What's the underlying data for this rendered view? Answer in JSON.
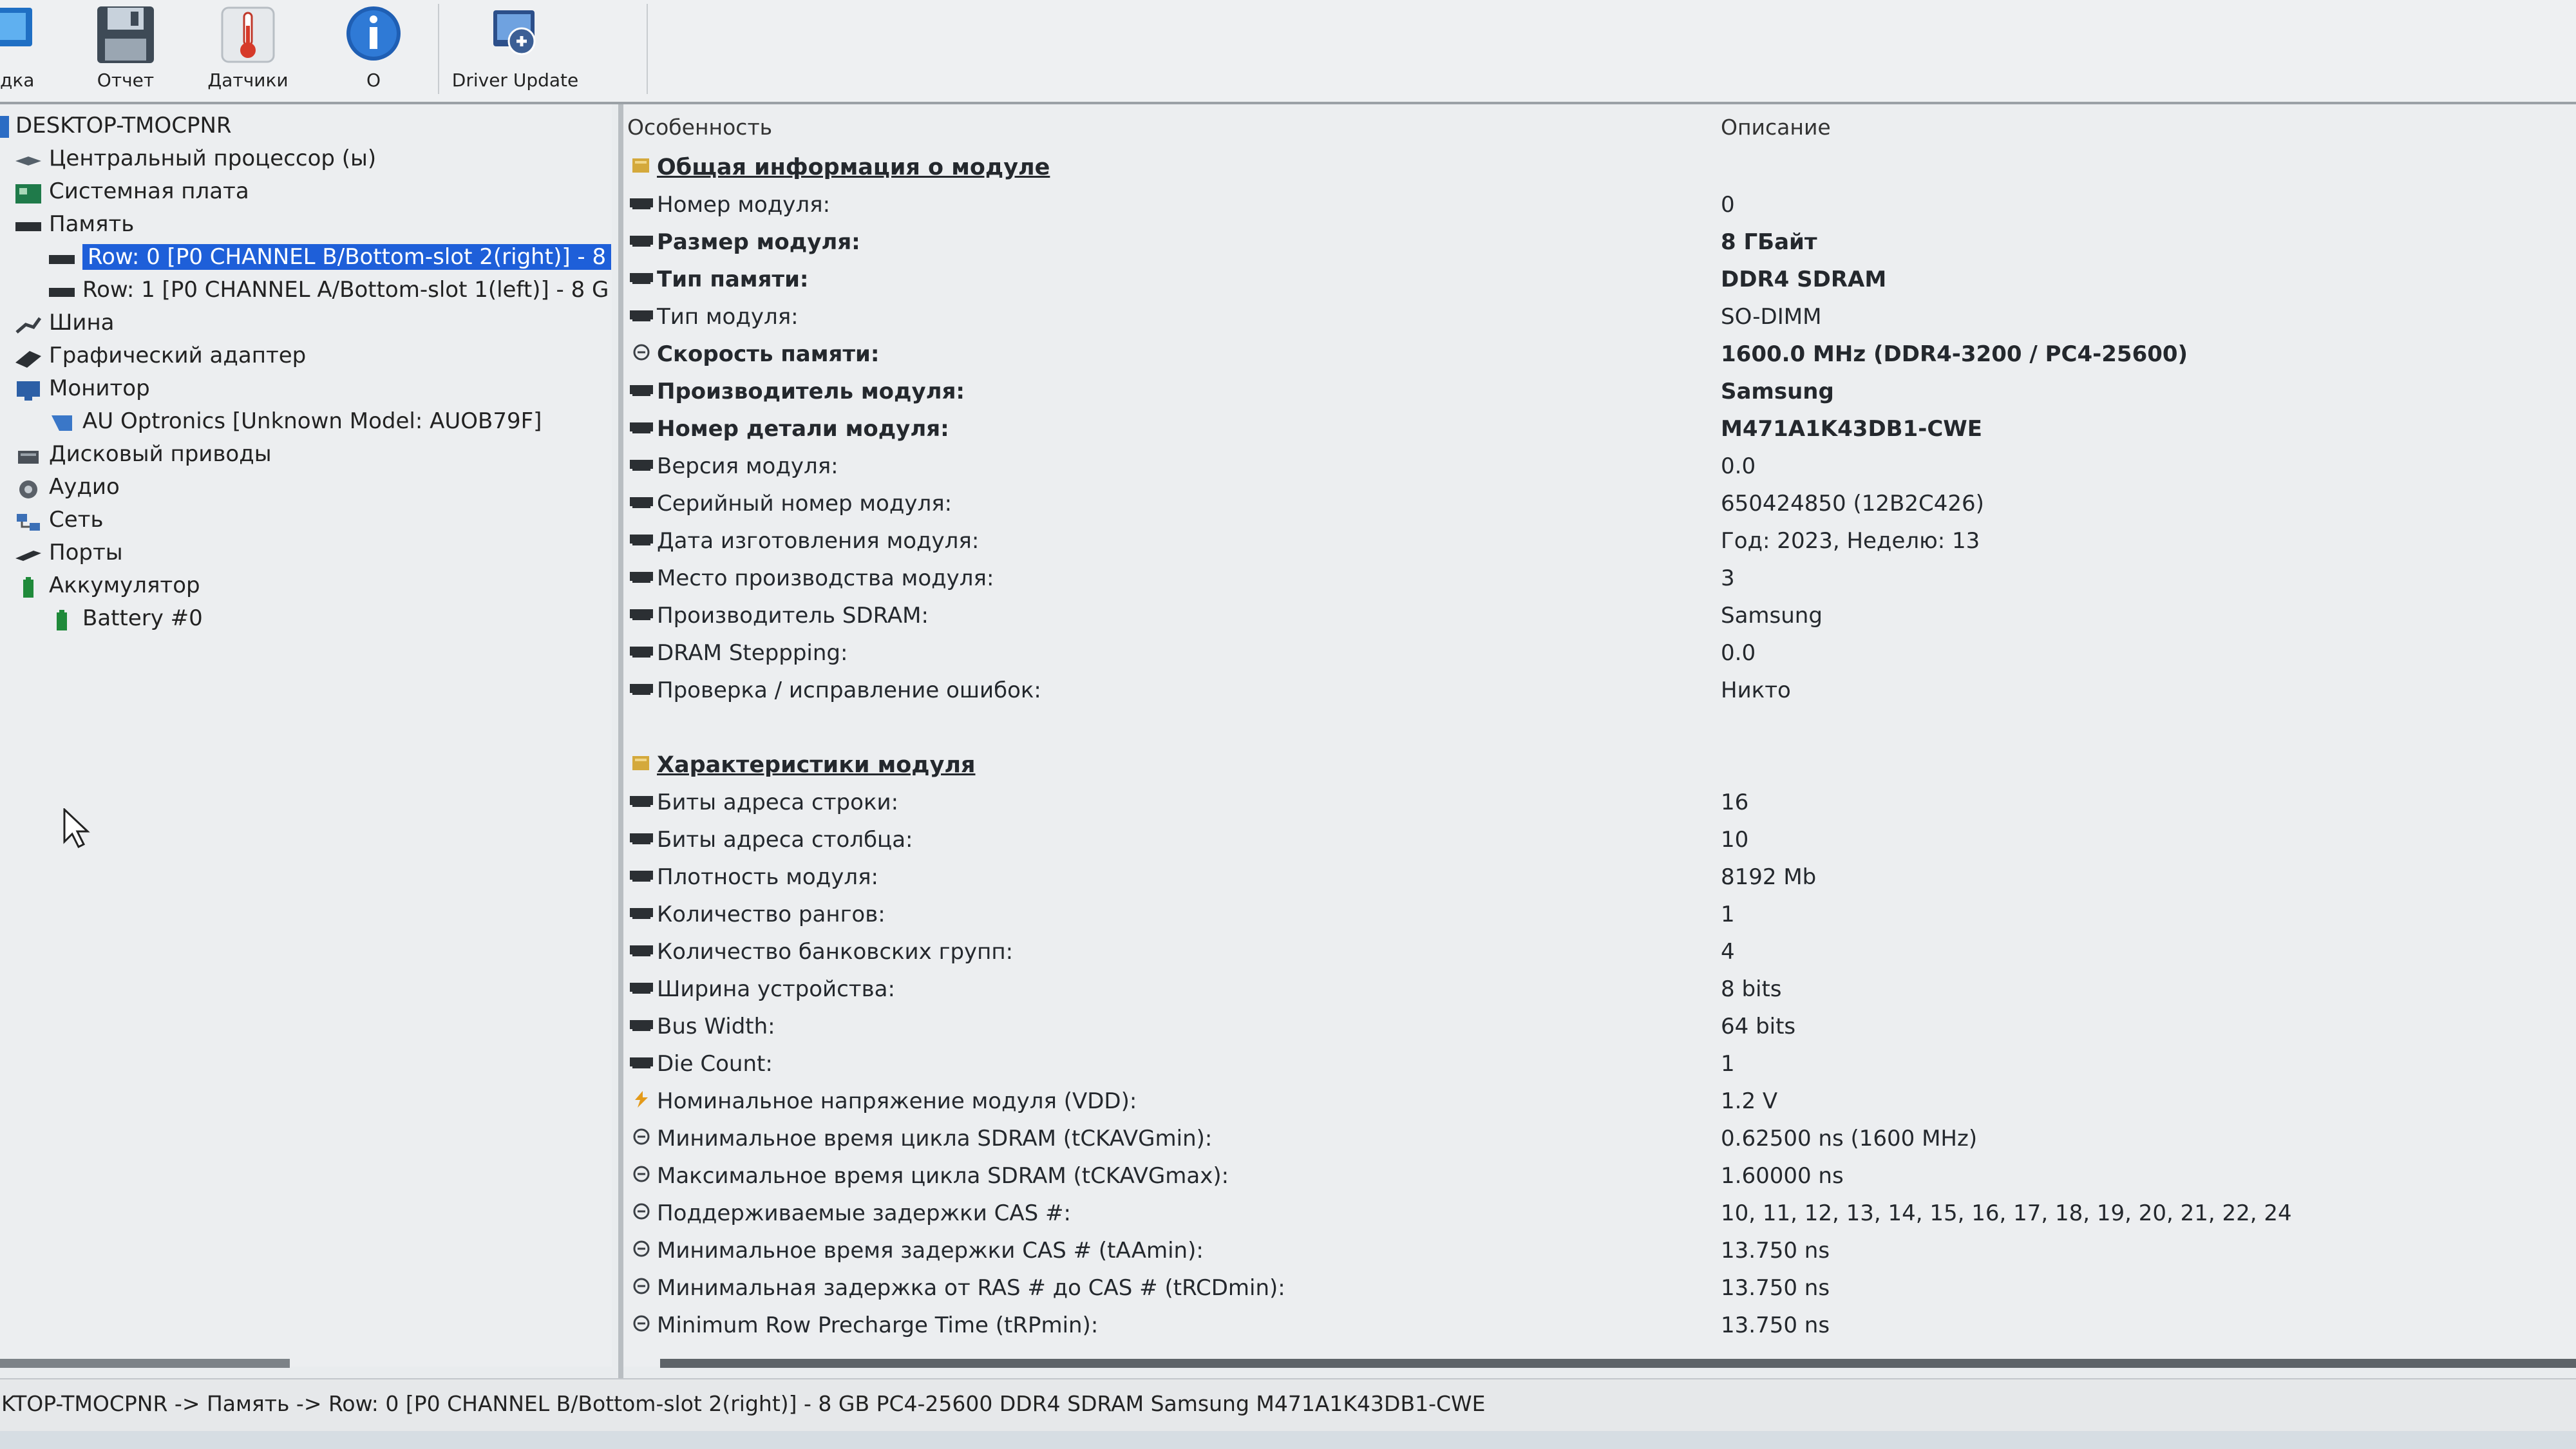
{
  "toolbar": {
    "buttons": [
      {
        "label": "дка",
        "icon": "monitor-icon"
      },
      {
        "label": "Отчет",
        "icon": "floppy-disk-icon"
      },
      {
        "label": "Датчики",
        "icon": "thermometer-icon"
      },
      {
        "label": "О",
        "icon": "info-icon"
      },
      {
        "label": "Driver Update",
        "icon": "driver-update-icon"
      }
    ]
  },
  "tree": {
    "items": [
      {
        "label": "DESKTOP-TMOCPNR",
        "icon": "computer-icon"
      },
      {
        "label": "Центральный процессор (ы)",
        "icon": "cpu-icon"
      },
      {
        "label": "Системная плата",
        "icon": "motherboard-icon"
      },
      {
        "label": "Память",
        "icon": "memory-icon"
      },
      {
        "label": "Row: 0 [P0 CHANNEL B/Bottom-slot 2(right)] - 8",
        "icon": "memory-module-icon",
        "selected": true
      },
      {
        "label": "Row: 1 [P0 CHANNEL A/Bottom-slot 1(left)] - 8 G",
        "icon": "memory-module-icon"
      },
      {
        "label": "Шина",
        "icon": "bus-icon"
      },
      {
        "label": "Графический адаптер",
        "icon": "gpu-icon"
      },
      {
        "label": "Монитор",
        "icon": "monitor-icon"
      },
      {
        "label": "AU Optronics [Unknown Model: AUOB79F]",
        "icon": "display-icon"
      },
      {
        "label": "Дисковый приводы",
        "icon": "disk-icon"
      },
      {
        "label": "Аудио",
        "icon": "audio-icon"
      },
      {
        "label": "Сеть",
        "icon": "network-icon"
      },
      {
        "label": "Порты",
        "icon": "ports-icon"
      },
      {
        "label": "Аккумулятор",
        "icon": "battery-icon"
      },
      {
        "label": "Battery #0",
        "icon": "battery-icon"
      }
    ]
  },
  "list": {
    "headers": {
      "feature": "Особенность",
      "description": "Описание"
    },
    "rows": [
      {
        "feature": "Общая информация о модуле",
        "value": "",
        "type": "section",
        "icon": "folder-icon"
      },
      {
        "feature": "Номер модуля:",
        "value": "0",
        "icon": "memory-module-icon"
      },
      {
        "feature": "Размер модуля:",
        "value": "8 ГБайт",
        "type": "bold",
        "icon": "memory-module-icon"
      },
      {
        "feature": "Тип памяти:",
        "value": "DDR4 SDRAM",
        "type": "bold",
        "icon": "memory-module-icon"
      },
      {
        "feature": "Тип модуля:",
        "value": "SO-DIMM",
        "icon": "memory-module-icon"
      },
      {
        "feature": "Скорость памяти:",
        "value": "1600.0 MHz (DDR4-3200 / PC4-25600)",
        "type": "bold",
        "icon": "clock-icon"
      },
      {
        "feature": "Производитель модуля:",
        "value": "Samsung",
        "type": "bold",
        "icon": "memory-module-icon"
      },
      {
        "feature": "Номер детали модуля:",
        "value": "M471A1K43DB1-CWE",
        "type": "bold",
        "icon": "memory-module-icon"
      },
      {
        "feature": "Версия модуля:",
        "value": "0.0",
        "icon": "memory-module-icon"
      },
      {
        "feature": "Серийный номер модуля:",
        "value": "650424850 (12B2C426)",
        "icon": "memory-module-icon"
      },
      {
        "feature": "Дата изготовления модуля:",
        "value": "Год: 2023, Неделю: 13",
        "icon": "memory-module-icon"
      },
      {
        "feature": "Место производства модуля:",
        "value": "3",
        "icon": "memory-module-icon"
      },
      {
        "feature": "Производитель SDRAM:",
        "value": "Samsung",
        "icon": "memory-module-icon"
      },
      {
        "feature": "DRAM Steppping:",
        "value": "0.0",
        "icon": "memory-module-icon"
      },
      {
        "feature": "Проверка / исправление ошибок:",
        "value": "Никто",
        "icon": "memory-module-icon"
      },
      {
        "feature": "Характеристики модуля",
        "value": "",
        "type": "section",
        "icon": "folder-icon",
        "gap": true
      },
      {
        "feature": "Биты адреса строки:",
        "value": "16",
        "icon": "memory-module-icon"
      },
      {
        "feature": "Биты адреса столбца:",
        "value": "10",
        "icon": "memory-module-icon"
      },
      {
        "feature": "Плотность модуля:",
        "value": "8192 Mb",
        "icon": "memory-module-icon"
      },
      {
        "feature": "Количество рангов:",
        "value": "1",
        "icon": "memory-module-icon"
      },
      {
        "feature": "Количество банковских групп:",
        "value": "4",
        "icon": "memory-module-icon"
      },
      {
        "feature": "Ширина устройства:",
        "value": "8 bits",
        "icon": "memory-module-icon"
      },
      {
        "feature": "Bus Width:",
        "value": "64 bits",
        "icon": "memory-module-icon"
      },
      {
        "feature": "Die Count:",
        "value": "1",
        "icon": "memory-module-icon"
      },
      {
        "feature": "Номинальное напряжение модуля (VDD):",
        "value": "1.2 V",
        "icon": "voltage-icon"
      },
      {
        "feature": "Минимальное время цикла SDRAM (tCKAVGmin):",
        "value": "0.62500 ns (1600 MHz)",
        "icon": "clock-icon"
      },
      {
        "feature": "Максимальное время цикла SDRAM (tCKAVGmax):",
        "value": "1.60000 ns",
        "icon": "clock-icon"
      },
      {
        "feature": "Поддерживаемые задержки CAS #:",
        "value": "10, 11, 12, 13, 14, 15, 16, 17, 18, 19, 20, 21, 22, 24",
        "icon": "clock-icon"
      },
      {
        "feature": "Минимальное время задержки CAS # (tAAmin):",
        "value": "13.750 ns",
        "icon": "clock-icon"
      },
      {
        "feature": "Минимальная задержка от RAS # до CAS # (tRCDmin):",
        "value": "13.750 ns",
        "icon": "clock-icon"
      },
      {
        "feature": "Minimum Row Precharge Time (tRPmin):",
        "value": "13.750 ns",
        "icon": "clock-icon"
      }
    ]
  },
  "status": {
    "path": "KTOP-TMOCPNR -> Память -> Row: 0 [P0 CHANNEL B/Bottom-slot 2(right)] - 8 GB PC4-25600 DDR4 SDRAM Samsung M471A1K43DB1-CWE"
  },
  "colors": {
    "selection": "#1e5fd9",
    "memory_icon": "#2b2f33",
    "folder_icon": "#d4a93c",
    "voltage_icon": "#e39a1a"
  }
}
